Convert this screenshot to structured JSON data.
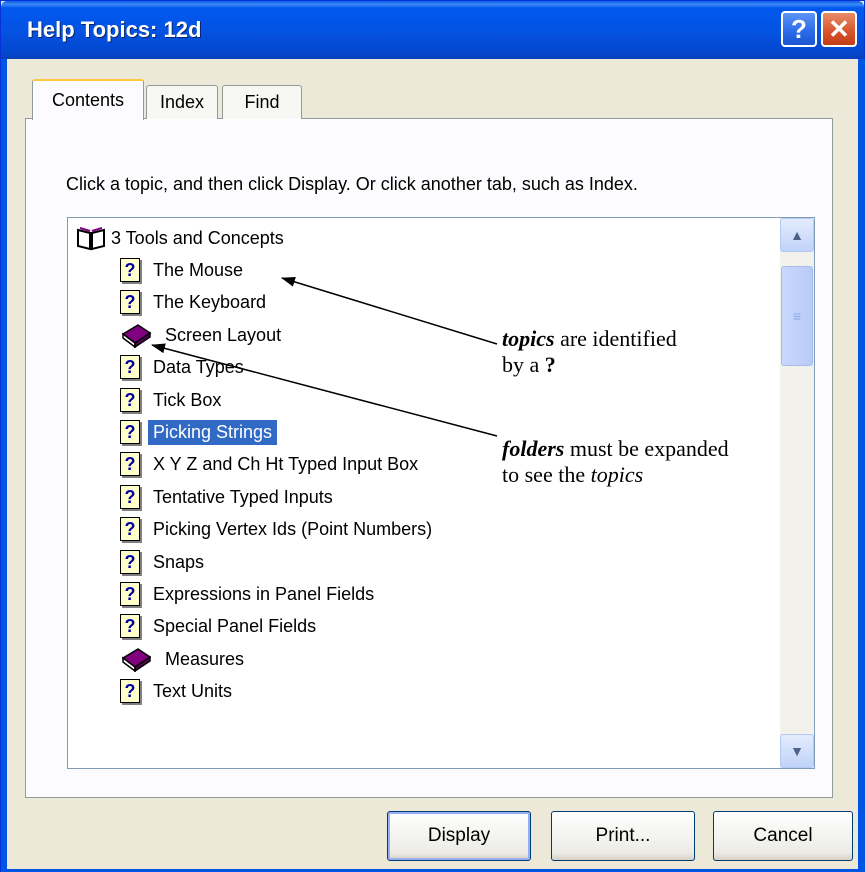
{
  "window": {
    "title": "Help Topics: 12d",
    "help_glyph": "?",
    "close_glyph": "✕"
  },
  "tabs": [
    {
      "label": "Contents",
      "active": true
    },
    {
      "label": "Index",
      "active": false
    },
    {
      "label": "Find",
      "active": false
    }
  ],
  "instruction": "Click a topic, and then click Display. Or click another tab, such as Index.",
  "tree": {
    "root": {
      "label": "3  Tools and Concepts",
      "icon": "open-book-icon"
    },
    "items": [
      {
        "label": "The Mouse",
        "icon": "topic-icon",
        "selected": false
      },
      {
        "label": "The Keyboard",
        "icon": "topic-icon",
        "selected": false
      },
      {
        "label": "Screen Layout",
        "icon": "book-icon",
        "selected": false
      },
      {
        "label": "Data Types",
        "icon": "topic-icon",
        "selected": false
      },
      {
        "label": "Tick Box",
        "icon": "topic-icon",
        "selected": false
      },
      {
        "label": "Picking Strings",
        "icon": "topic-icon",
        "selected": true
      },
      {
        "label": "X Y Z and Ch Ht Typed Input Box",
        "icon": "topic-icon",
        "selected": false
      },
      {
        "label": "Tentative Typed Inputs",
        "icon": "topic-icon",
        "selected": false
      },
      {
        "label": "Picking Vertex Ids (Point Numbers)",
        "icon": "topic-icon",
        "selected": false
      },
      {
        "label": "Snaps",
        "icon": "topic-icon",
        "selected": false
      },
      {
        "label": "Expressions in Panel Fields",
        "icon": "topic-icon",
        "selected": false
      },
      {
        "label": "Special Panel Fields",
        "icon": "topic-icon",
        "selected": false
      },
      {
        "label": "Measures",
        "icon": "book-icon",
        "selected": false
      },
      {
        "label": "Text Units",
        "icon": "topic-icon",
        "selected": false
      }
    ],
    "topic_glyph": "?"
  },
  "buttons": {
    "display": "Display",
    "print": "Print...",
    "cancel": "Cancel"
  },
  "annotations": {
    "topics_keyword": "topics",
    "topics_rest_line1": " are identified",
    "topics_line2_prefix": "by a ",
    "topics_line2_symbol": "?",
    "folders_keyword": "folders",
    "folders_rest_line1": " must be expanded",
    "folders_line2_prefix": "to see the ",
    "folders_line2_keyword": "topics"
  },
  "colors": {
    "titlebar": "#0453e3",
    "selection": "#316ac5",
    "book": "#800080",
    "dialog_bg": "#ece9d8"
  }
}
